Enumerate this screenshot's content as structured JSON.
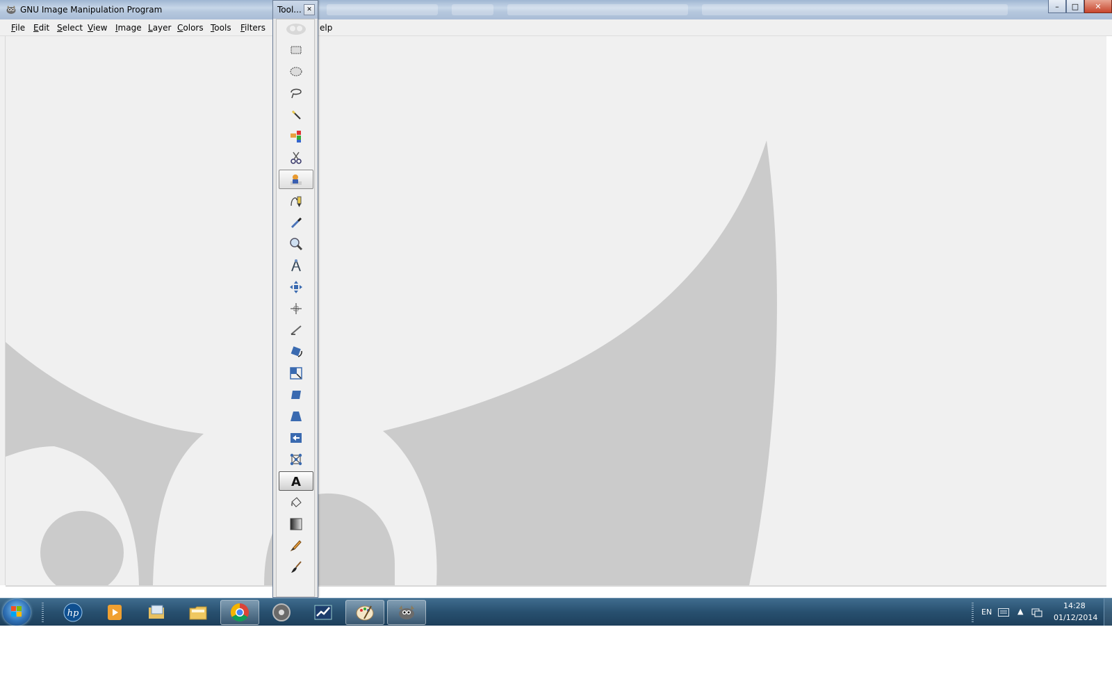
{
  "window": {
    "title": "GNU Image Manipulation Program"
  },
  "menu": {
    "items": [
      {
        "label": "File",
        "key": "F",
        "rest": "ile"
      },
      {
        "label": "Edit",
        "key": "E",
        "rest": "dit"
      },
      {
        "label": "Select",
        "key": "S",
        "rest": "elect"
      },
      {
        "label": "View",
        "key": "V",
        "rest": "iew"
      },
      {
        "label": "Image",
        "key": "I",
        "rest": "mage"
      },
      {
        "label": "Layer",
        "key": "L",
        "rest": "ayer"
      },
      {
        "label": "Colors",
        "key": "C",
        "rest": "olors"
      },
      {
        "label": "Tools",
        "key": "T",
        "rest": "ools"
      },
      {
        "label": "Filters",
        "key": "F",
        "rest": "ilters"
      }
    ],
    "help_partial": "elp"
  },
  "toolbox": {
    "title": "Tool...",
    "tools": [
      "rect-select",
      "ellipse-select",
      "free-select",
      "fuzzy-select",
      "select-by-color",
      "scissors-select",
      "foreground-select",
      "paths",
      "color-picker",
      "zoom",
      "measure",
      "move",
      "align",
      "crop",
      "rotate",
      "scale",
      "shear",
      "perspective",
      "flip",
      "cage-transform",
      "text",
      "bucket-fill",
      "blend",
      "pencil",
      "paintbrush"
    ],
    "active_tool": "text"
  },
  "taskbar": {
    "apps": [
      "hp-support",
      "media-player",
      "windows-explorer-mail",
      "file-explorer",
      "chrome",
      "gimp-settings",
      "stocks-app",
      "paint",
      "gimp"
    ],
    "language": "EN",
    "time": "14:28",
    "date": "01/12/2014"
  },
  "colors": {
    "canvas": "#f0f0f0",
    "wilber_shape": "#cbcbcb",
    "taskbar": "#28506f"
  }
}
